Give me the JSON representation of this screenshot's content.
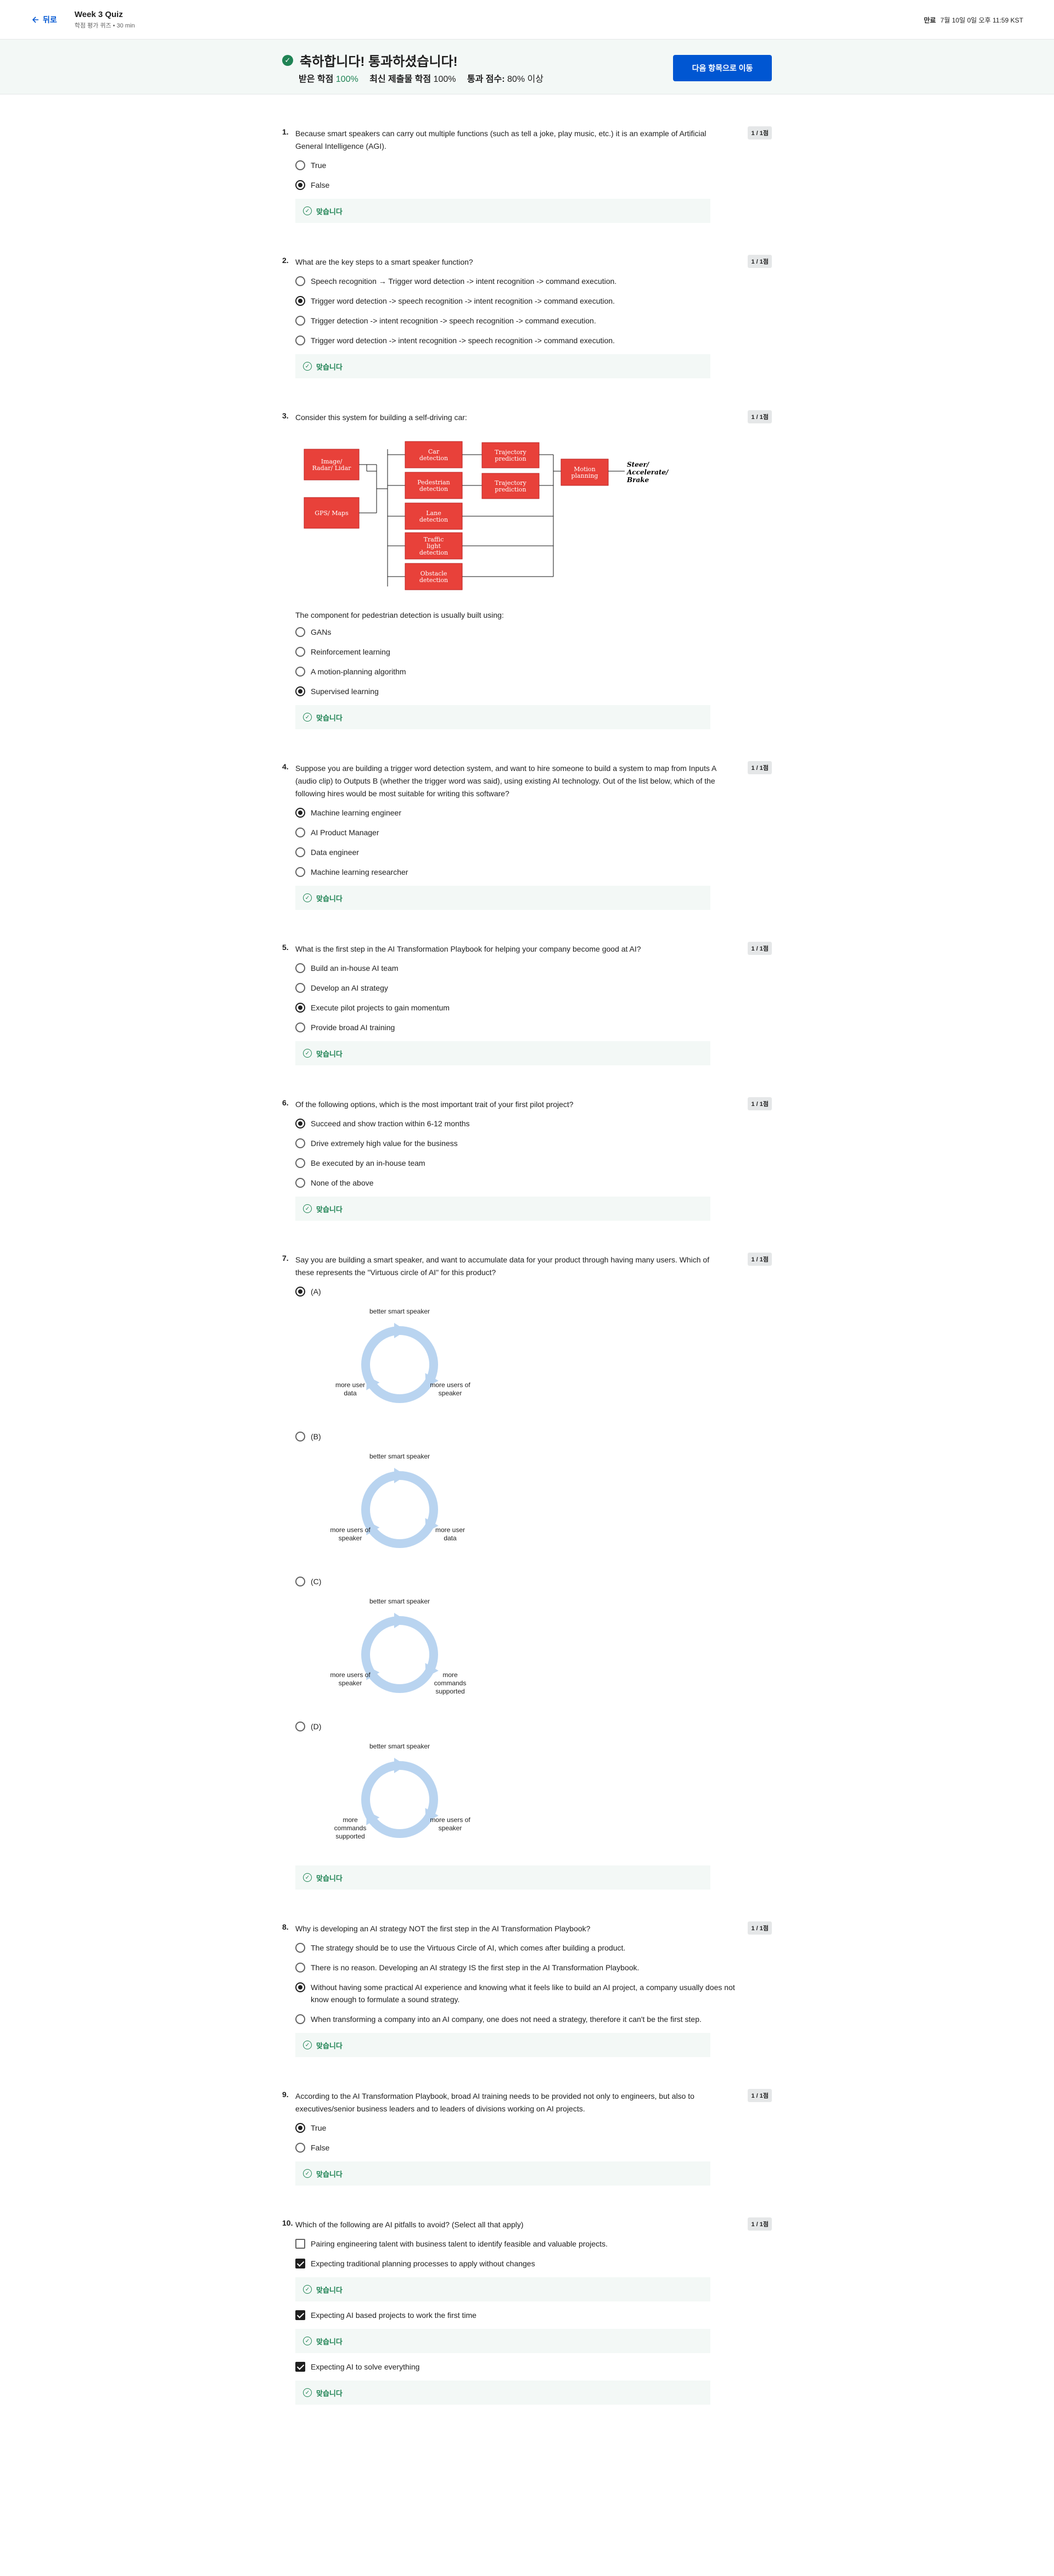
{
  "header": {
    "back_label": "뒤로",
    "quiz_title": "Week 3 Quiz",
    "quiz_subtitle": "학점 평가 퀴즈 • 30 min",
    "due_label": "만료",
    "due_value": "7월 10일 0일 오후 11:59 KST"
  },
  "banner": {
    "title": "축하합니다! 통과하셨습니다!",
    "received_label": "받은 학점",
    "received_value": "100%",
    "latest_label": "최신 제출물 학점",
    "latest_value": "100%",
    "pass_label": "통과 점수:",
    "pass_value": "80% 이상",
    "next_button": "다음 항목으로 이동"
  },
  "feedback_label": "맞습니다",
  "colors": {
    "accent": "#0056d2",
    "success": "#1f8354",
    "diagram_box": "#e8413a",
    "cycle": "#b9d4f0"
  },
  "questions": [
    {
      "number": "1.",
      "points": "1 / 1점",
      "prompt": "Because smart speakers can carry out multiple functions (such as tell a joke, play music, etc.) it is an example of Artificial General Intelligence (AGI).",
      "options": [
        {
          "label": "True",
          "selected": false
        },
        {
          "label": "False",
          "selected": true
        }
      ]
    },
    {
      "number": "2.",
      "points": "1 / 1점",
      "prompt": "What are the key steps to a smart speaker function?",
      "options": [
        {
          "label": "Speech recognition → Trigger word detection -> intent recognition -> command execution.",
          "selected": false
        },
        {
          "label": "Trigger word detection -> speech recognition -> intent recognition -> command execution.",
          "selected": true
        },
        {
          "label": "Trigger detection -> intent recognition -> speech recognition -> command execution.",
          "selected": false
        },
        {
          "label": "Trigger word detection -> intent recognition -> speech recognition -> command execution.",
          "selected": false
        }
      ]
    },
    {
      "number": "3.",
      "points": "1 / 1점",
      "prompt": "Consider this system for building a self-driving car:",
      "diagram": {
        "inputs": [
          "Image/ Radar/ Lidar",
          "GPS/ Maps"
        ],
        "detections": [
          "Car detection",
          "Pedestrian detection",
          "Lane detection",
          "Traffic light detection",
          "Obstacle detection"
        ],
        "predictions": [
          "Trajectory prediction",
          "Trajectory prediction"
        ],
        "planner": "Motion planning",
        "output": "Steer/ Accelerate/ Brake"
      },
      "subprompt": "The component for pedestrian detection is usually built using:",
      "options": [
        {
          "label": "GANs",
          "selected": false
        },
        {
          "label": "Reinforcement learning",
          "selected": false
        },
        {
          "label": "A motion-planning algorithm",
          "selected": false
        },
        {
          "label": "Supervised learning",
          "selected": true
        }
      ]
    },
    {
      "number": "4.",
      "points": "1 / 1점",
      "prompt": "Suppose you are building a trigger word detection system, and want to hire someone to build a system to map from Inputs A (audio clip) to Outputs B (whether the trigger word was said), using existing AI technology. Out of the list below, which of the following hires would be most suitable for writing this software?",
      "options": [
        {
          "label": "Machine learning engineer",
          "selected": true
        },
        {
          "label": "AI Product Manager",
          "selected": false
        },
        {
          "label": "Data engineer",
          "selected": false
        },
        {
          "label": "Machine learning researcher",
          "selected": false
        }
      ]
    },
    {
      "number": "5.",
      "points": "1 / 1점",
      "prompt": "What is the first step in the AI Transformation Playbook for helping your company become good at AI?",
      "options": [
        {
          "label": "Build an in-house AI team",
          "selected": false
        },
        {
          "label": "Develop an AI strategy",
          "selected": false
        },
        {
          "label": "Execute pilot projects to gain momentum",
          "selected": true
        },
        {
          "label": "Provide broad AI training",
          "selected": false
        }
      ]
    },
    {
      "number": "6.",
      "points": "1 / 1점",
      "prompt": "Of the following options, which is the most important trait of your first pilot project?",
      "options": [
        {
          "label": "Succeed and show traction within 6-12 months",
          "selected": true
        },
        {
          "label": "Drive extremely high value for the business",
          "selected": false
        },
        {
          "label": "Be executed by an in-house team",
          "selected": false
        },
        {
          "label": "None of the above",
          "selected": false
        }
      ]
    },
    {
      "number": "7.",
      "points": "1 / 1점",
      "prompt": "Say you are building a smart speaker, and want to accumulate data for your product through having many users. Which of these represents the \"Virtuous circle of AI\" for this product?",
      "cycles": [
        {
          "label": "(A)",
          "selected": true,
          "top": "better smart speaker",
          "left": "more user data",
          "right": "more users of speaker"
        },
        {
          "label": "(B)",
          "selected": false,
          "top": "better smart speaker",
          "left": "more users of speaker",
          "right": "more user data"
        },
        {
          "label": "(C)",
          "selected": false,
          "top": "better smart speaker",
          "left": "more users of speaker",
          "right": "more commands supported"
        },
        {
          "label": "(D)",
          "selected": false,
          "top": "better smart speaker",
          "left": "more commands supported",
          "right": "more users of speaker"
        }
      ]
    },
    {
      "number": "8.",
      "points": "1 / 1점",
      "prompt": "Why is developing an AI strategy NOT the first step in the AI Transformation Playbook?",
      "options": [
        {
          "label": "The strategy should be to use the Virtuous Circle of AI, which comes after building a product.",
          "selected": false
        },
        {
          "label": "There is no reason. Developing an AI strategy IS the first step in the AI Transformation Playbook.",
          "selected": false
        },
        {
          "label": "Without having some practical AI experience and knowing what it feels like to build an AI project, a company usually does not know enough to formulate a sound strategy.",
          "selected": true
        },
        {
          "label": "When transforming a company into an AI company, one does not need a strategy, therefore it can't be the first step.",
          "selected": false
        }
      ]
    },
    {
      "number": "9.",
      "points": "1 / 1점",
      "prompt": "According to the AI Transformation Playbook, broad AI training needs to be provided not only to engineers, but also to executives/senior business leaders and to leaders of divisions working on AI projects.",
      "options": [
        {
          "label": "True",
          "selected": true
        },
        {
          "label": "False",
          "selected": false
        }
      ]
    },
    {
      "number": "10.",
      "points": "1 / 1점",
      "prompt": "Which of the following are AI pitfalls to avoid? (Select all that apply)",
      "checks": [
        {
          "label": "Pairing engineering talent with business talent to identify feasible and valuable projects.",
          "selected": false,
          "feedback": false
        },
        {
          "label": "Expecting traditional planning processes to apply without changes",
          "selected": true,
          "feedback": true
        },
        {
          "label": "Expecting AI based projects to work the first time",
          "selected": true,
          "feedback": true
        },
        {
          "label": "Expecting AI to solve everything",
          "selected": true,
          "feedback": true
        }
      ]
    }
  ]
}
